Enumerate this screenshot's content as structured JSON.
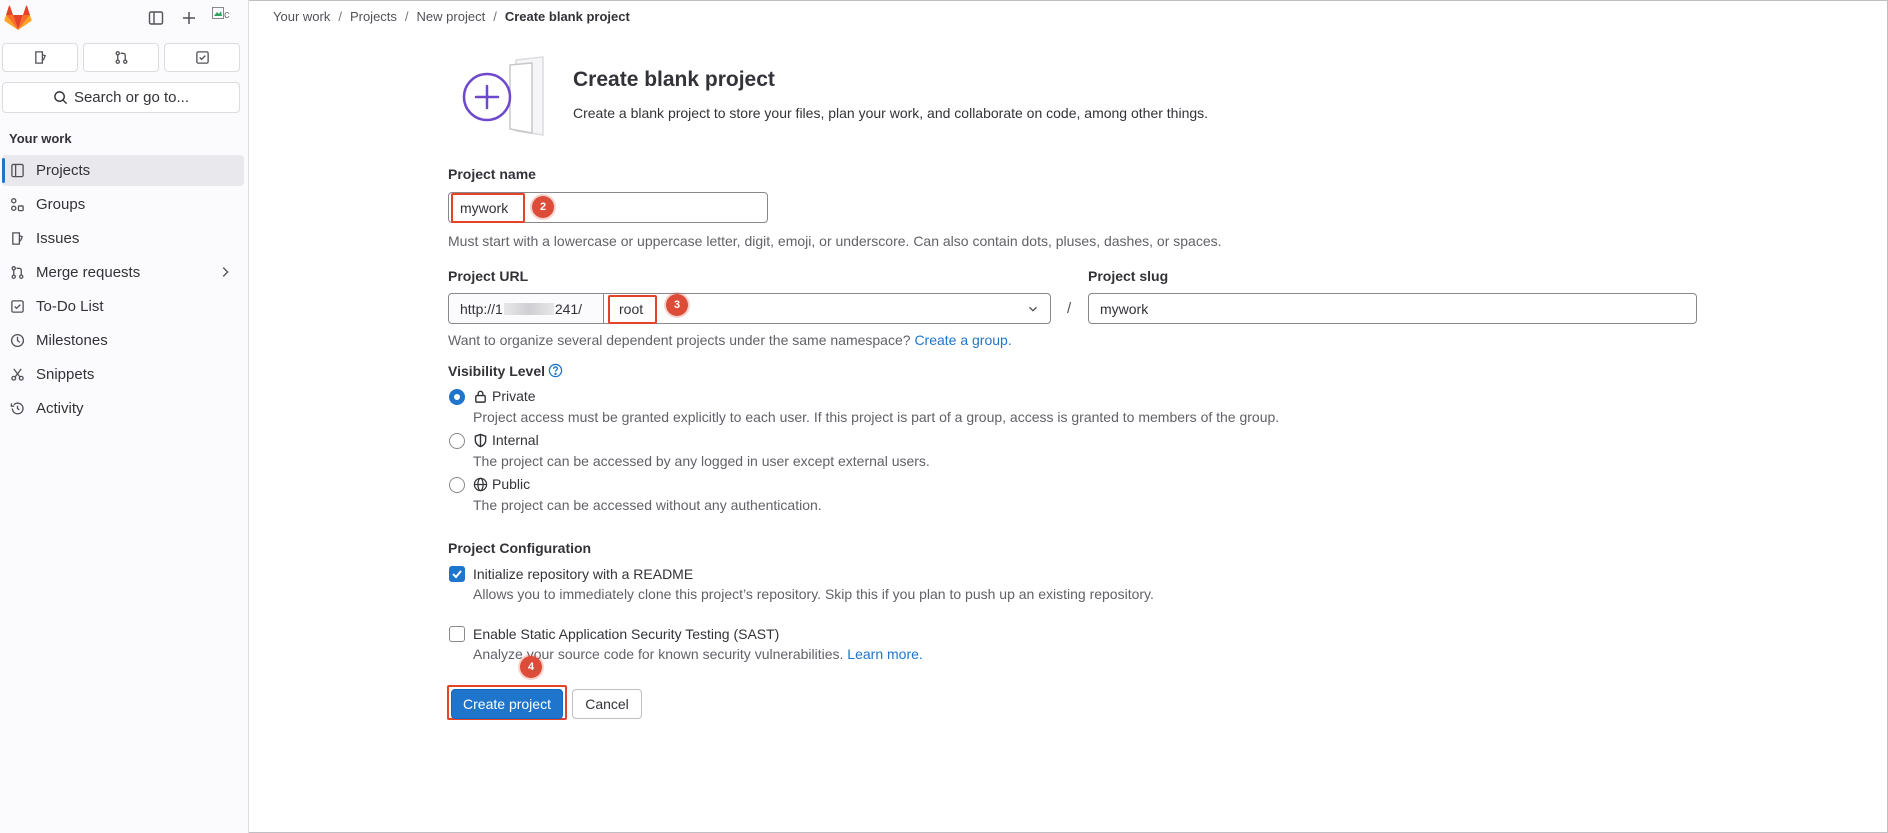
{
  "sidebar": {
    "search_label": "Search or go to...",
    "avatar_alt": "c",
    "section_title": "Your work",
    "items": [
      {
        "label": "Projects",
        "icon": "project-icon",
        "active": true
      },
      {
        "label": "Groups",
        "icon": "group-icon"
      },
      {
        "label": "Issues",
        "icon": "issues-icon"
      },
      {
        "label": "Merge requests",
        "icon": "merge-request-icon"
      },
      {
        "label": "To-Do List",
        "icon": "todo-icon"
      },
      {
        "label": "Milestones",
        "icon": "milestone-icon"
      },
      {
        "label": "Snippets",
        "icon": "snippet-icon"
      },
      {
        "label": "Activity",
        "icon": "history-icon"
      }
    ]
  },
  "breadcrumb": [
    "Your work",
    "Projects",
    "New project",
    "Create blank project"
  ],
  "header": {
    "title": "Create blank project",
    "description": "Create a blank project to store your files, plan your work, and collaborate on code, among other things."
  },
  "form": {
    "project_name": {
      "label": "Project name",
      "value": "mywork",
      "help": "Must start with a lowercase or uppercase letter, digit, emoji, or underscore. Can also contain dots, pluses, dashes, or spaces."
    },
    "project_url": {
      "label": "Project URL",
      "prefix_start": "http://1",
      "prefix_end": "241/",
      "namespace": "root",
      "help_text": "Want to organize several dependent projects under the same namespace?",
      "help_link": "Create a group."
    },
    "slash": "/",
    "project_slug": {
      "label": "Project slug",
      "value": "mywork"
    },
    "visibility": {
      "label": "Visibility Level",
      "options": [
        {
          "title": "Private",
          "desc": "Project access must be granted explicitly to each user. If this project is part of a group, access is granted to members of the group.",
          "selected": true
        },
        {
          "title": "Internal",
          "desc": "The project can be accessed by any logged in user except external users.",
          "selected": false
        },
        {
          "title": "Public",
          "desc": "The project can be accessed without any authentication.",
          "selected": false
        }
      ]
    },
    "configuration": {
      "label": "Project Configuration",
      "readme": {
        "title": "Initialize repository with a README",
        "desc": "Allows you to immediately clone this project’s repository. Skip this if you plan to push up an existing repository.",
        "checked": true
      },
      "sast": {
        "title": "Enable Static Application Security Testing (SAST)",
        "desc": "Analyze your source code for known security vulnerabilities.",
        "link": "Learn more.",
        "checked": false
      }
    },
    "buttons": {
      "create": "Create project",
      "cancel": "Cancel"
    }
  },
  "annotations": {
    "step2": "2",
    "step3": "3",
    "step4": "4"
  },
  "colors": {
    "accent": "#1f75cb",
    "highlight": "#e24329",
    "step_badge": "#dd4b39"
  }
}
